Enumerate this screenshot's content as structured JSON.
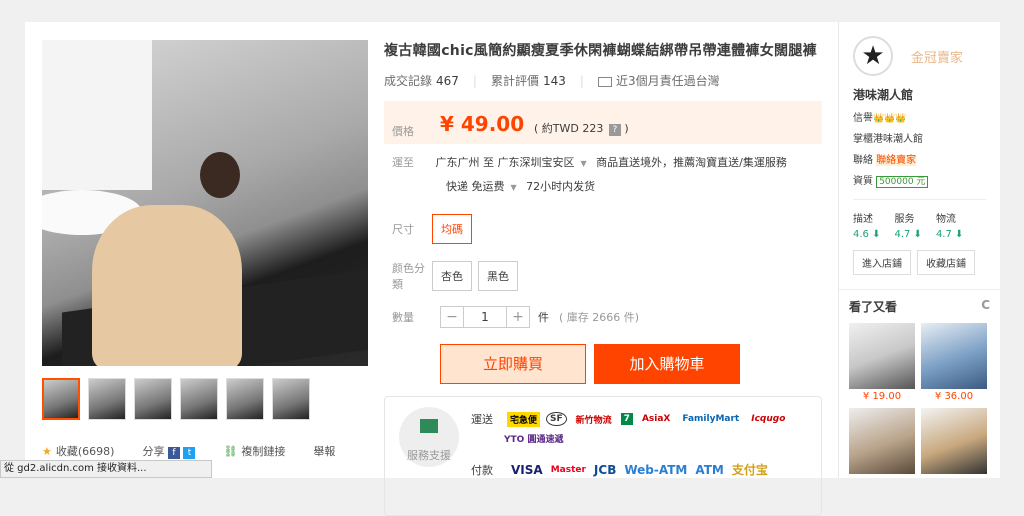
{
  "product": {
    "title": "複古韓國chic風簡約顯瘦夏季休閑褲蝴蝶結綁帶吊帶連體褲女闊腿褲",
    "sales_label": "成交記錄",
    "sales_value": "467",
    "reviews_label": "累計評價",
    "reviews_value": "143",
    "shipping_note": "近3個月責任過台灣"
  },
  "price": {
    "label": "價格",
    "value": "¥ 49.00",
    "twd": "( 約TWD 223",
    "twd_close": ")",
    "help_icon": "?"
  },
  "delivery": {
    "label": "運至",
    "from": "广东广州 至",
    "to": "广东深圳宝安区",
    "note": "商品直送境外，推薦淘寶直送/集運服務",
    "method": "快递 免运费",
    "time": "72小时内发货"
  },
  "size": {
    "label": "尺寸",
    "options": [
      "均碼"
    ]
  },
  "color": {
    "label": "颜色分類",
    "options": [
      "杏色",
      "黑色"
    ]
  },
  "quantity": {
    "label": "數量",
    "minus": "−",
    "value": "1",
    "plus": "+",
    "unit": "件",
    "stock": "( 庫存 2666 件)"
  },
  "buttons": {
    "buy": "立即購買",
    "cart": "加入購物車"
  },
  "service": {
    "label": "服務支援",
    "ship_label": "運送",
    "carriers": [
      "宅急便",
      "SF",
      "新竹物流",
      "7",
      "AsiaX",
      "FamilyMart",
      "Icqugo",
      "YTO 圓通速遞"
    ],
    "pay_label": "付款",
    "payments": [
      "VISA",
      "Master",
      "JCB",
      "Web-ATM",
      "ATM",
      "支付宝"
    ]
  },
  "share": {
    "favorite": "收藏(6698)",
    "share": "分享",
    "fb": "f",
    "tw": "t",
    "copy_link": "複制鏈接",
    "report": "舉報"
  },
  "seller": {
    "badge": "金冠賣家",
    "name": "港味潮人館",
    "credit_label": "信譽",
    "credit_crowns": "👑👑👑",
    "keeper_label": "掌櫃",
    "keeper_value": "港味潮人館",
    "contact_label": "聯絡",
    "contact_value": "聯絡賣家",
    "deposit_label": "資質",
    "deposit_value": "500000 元",
    "ratings": [
      {
        "label": "描述",
        "value": "4.6 ⬇"
      },
      {
        "label": "服务",
        "value": "4.7 ⬇"
      },
      {
        "label": "物流",
        "value": "4.7 ⬇"
      }
    ],
    "enter_store": "進入店鋪",
    "fav_store": "收藏店鋪"
  },
  "see_also": {
    "title": "看了又看",
    "refresh_icon": "C",
    "items": [
      {
        "price": "¥ 19.00"
      },
      {
        "price": "¥ 36.00"
      },
      {
        "price": ""
      },
      {
        "price": ""
      }
    ]
  },
  "status_bar": "從 gd2.alicdn.com 接收資料..."
}
